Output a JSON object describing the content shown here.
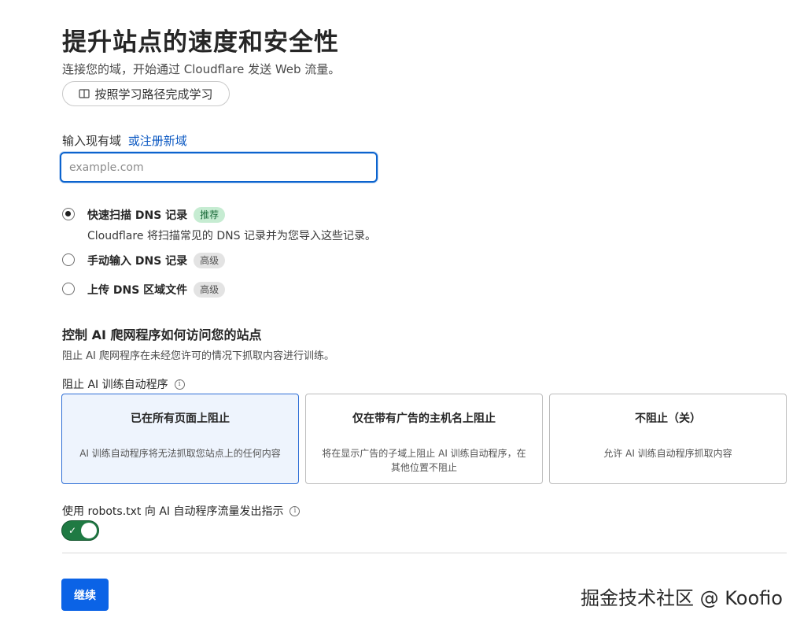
{
  "header": {
    "title": "提升站点的速度和安全性",
    "subtitle": "连接您的域，开始通过 Cloudflare 发送 Web 流量。",
    "learn_button": "按照学习路径完成学习"
  },
  "domain": {
    "label": "输入现有域",
    "register_link": "或注册新域",
    "placeholder": "example.com",
    "value": ""
  },
  "dns_options": [
    {
      "title": "快速扫描 DNS 记录",
      "badge": "推荐",
      "description": "Cloudflare 将扫描常见的 DNS 记录并为您导入这些记录。",
      "selected": true
    },
    {
      "title": "手动输入 DNS 记录",
      "badge": "高级",
      "selected": false
    },
    {
      "title": "上传 DNS 区域文件",
      "badge": "高级",
      "selected": false
    }
  ],
  "ai_crawlers": {
    "title": "控制 AI 爬网程序如何访问您的站点",
    "description": "阻止 AI 爬网程序在未经您许可的情况下抓取内容进行训练。",
    "block_label": "阻止 AI 训练自动程序",
    "options": [
      {
        "title": "已在所有页面上阻止",
        "description": "AI 训练自动程序将无法抓取您站点上的任何内容",
        "selected": true
      },
      {
        "title": "仅在带有广告的主机名上阻止",
        "description": "将在显示广告的子域上阻止 AI 训练自动程序，在其他位置不阻止",
        "selected": false
      },
      {
        "title": "不阻止（关）",
        "description": "允许 AI 训练自动程序抓取内容",
        "selected": false
      }
    ],
    "robots_label": "使用 robots.txt 向 AI 自动程序流量发出指示",
    "robots_enabled": true
  },
  "footer": {
    "continue_label": "继续",
    "watermark": "掘金技术社区 @ Koofio"
  },
  "icons": {
    "learn": "book-icon",
    "info": "info-icon",
    "toggle_check": "check-icon"
  },
  "colors": {
    "primary": "#0b63e6",
    "link": "#0b58c2",
    "toggle_on": "#1f7a43",
    "badge_green_bg": "#c6ecd2",
    "selected_card_bg": "#eef4fd"
  }
}
